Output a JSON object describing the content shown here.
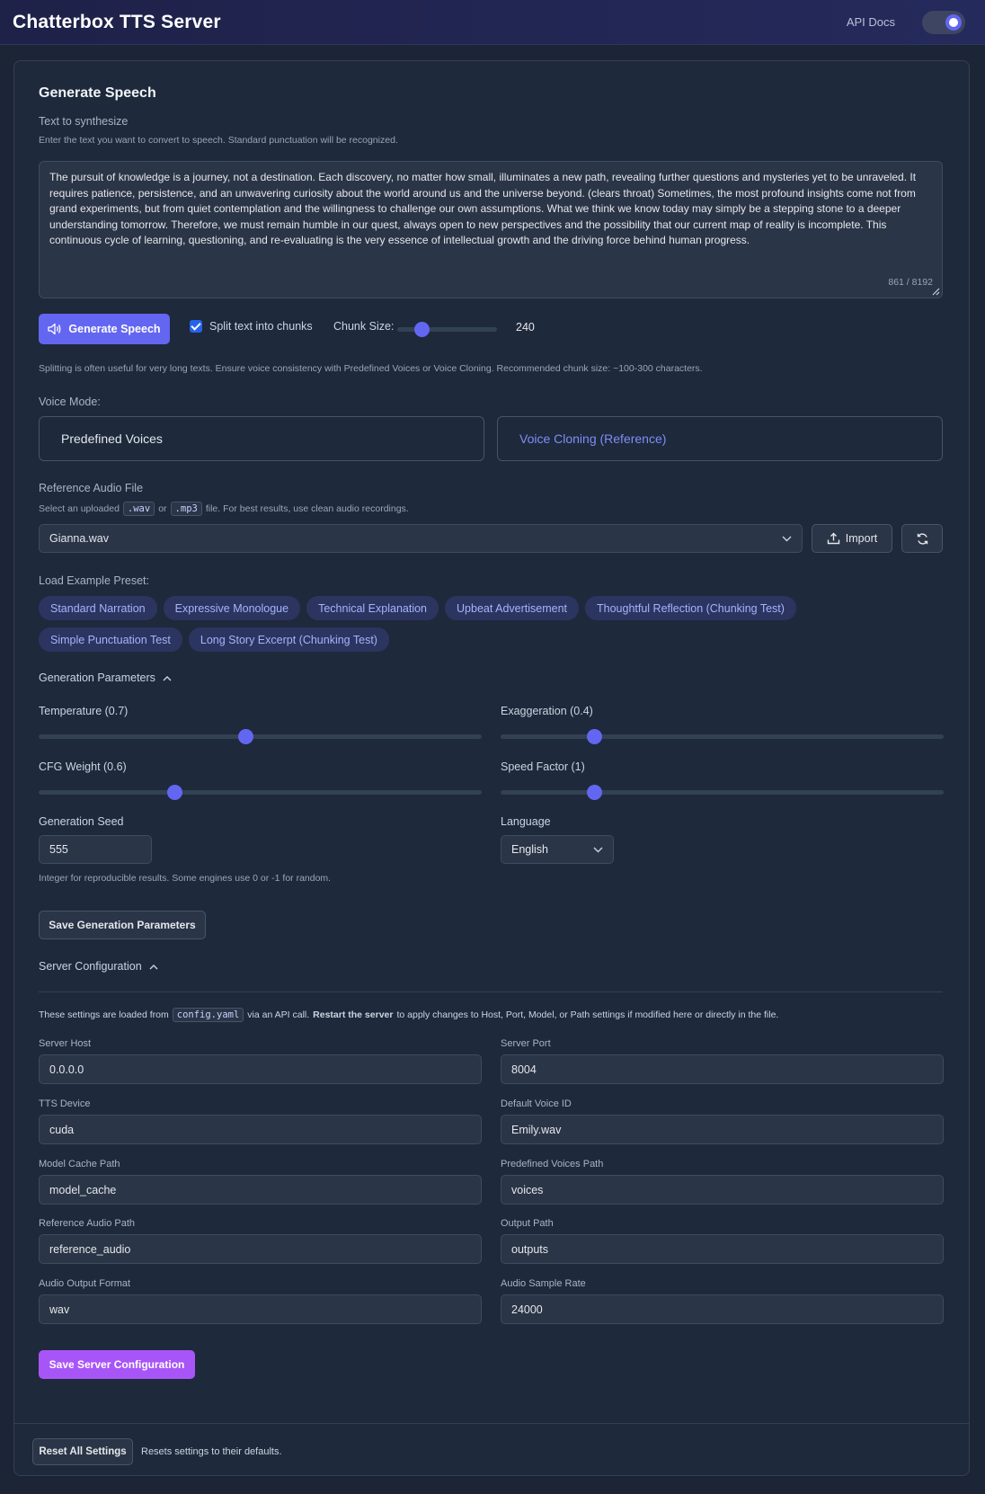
{
  "app": {
    "title": "Chatterbox TTS Server",
    "api_docs": "API Docs"
  },
  "generate": {
    "heading": "Generate Speech",
    "text_label": "Text to synthesize",
    "text_help": "Enter the text you want to convert to speech. Standard punctuation will be recognized.",
    "text_value": "The pursuit of knowledge is a journey, not a destination. Each discovery, no matter how small, illuminates a new path, revealing further questions and mysteries yet to be unraveled. It requires patience, persistence, and an unwavering curiosity about the world around us and the universe beyond. (clears throat) Sometimes, the most profound insights come not from grand experiments, but from quiet contemplation and the willingness to challenge our own assumptions. What we think we know today may simply be a stepping stone to a deeper understanding tomorrow. Therefore, we must remain humble in our quest, always open to new perspectives and the possibility that our current map of reality is incomplete. This continuous cycle of learning, questioning, and re-evaluating is the very essence of intellectual growth and the driving force behind human progress.",
    "char_count": "861 / 8192",
    "button": "Generate Speech",
    "split_label": "Split text into chunks",
    "split_checked": true,
    "chunk_label": "Chunk Size:",
    "chunk_value": "240",
    "chunk_fraction": 0.24,
    "chunk_help": "Splitting is often useful for very long texts. Ensure voice consistency with Predefined Voices or Voice Cloning. Recommended chunk size: ~100-300 characters."
  },
  "voice_mode": {
    "label": "Voice Mode:",
    "predefined": "Predefined Voices",
    "cloning": "Voice Cloning (Reference)",
    "selected": "Voice Cloning (Reference)"
  },
  "reference": {
    "label": "Reference Audio File",
    "help_prefix": "Select an uploaded",
    "ext1": ".wav",
    "help_or": "or",
    "ext2": ".mp3",
    "help_suffix": "file. For best results, use clean audio recordings.",
    "selected_file": "Gianna.wav",
    "import_button": "Import"
  },
  "presets": {
    "label": "Load Example Preset:",
    "items": [
      "Standard Narration",
      "Expressive Monologue",
      "Technical Explanation",
      "Upbeat Advertisement",
      "Thoughtful Reflection (Chunking Test)",
      "Simple Punctuation Test",
      "Long Story Excerpt (Chunking Test)"
    ]
  },
  "gen_params": {
    "heading": "Generation Parameters",
    "temperature_label": "Temperature (0.7)",
    "temperature_fraction": 0.467,
    "exaggeration_label": "Exaggeration (0.4)",
    "exaggeration_fraction": 0.21,
    "cfg_label": "CFG Weight (0.6)",
    "cfg_fraction": 0.307,
    "speed_label": "Speed Factor (1)",
    "speed_fraction": 0.21,
    "seed_label": "Generation Seed",
    "seed_value": "555",
    "seed_help": "Integer for reproducible results. Some engines use 0 or -1 for random.",
    "language_label": "Language",
    "language_value": "English",
    "save_button": "Save Generation Parameters"
  },
  "server_config": {
    "heading": "Server Configuration",
    "help_prefix": "These settings are loaded from",
    "config_file": "config.yaml",
    "help_mid": "via an API call.",
    "help_bold": "Restart the server",
    "help_suffix": "to apply changes to Host, Port, Model, or Path settings if modified here or directly in the file.",
    "fields": {
      "host_label": "Server Host",
      "host_value": "0.0.0.0",
      "port_label": "Server Port",
      "port_value": "8004",
      "device_label": "TTS Device",
      "device_value": "cuda",
      "voice_label": "Default Voice ID",
      "voice_value": "Emily.wav",
      "cache_label": "Model Cache Path",
      "cache_value": "model_cache",
      "voices_path_label": "Predefined Voices Path",
      "voices_path_value": "voices",
      "ref_path_label": "Reference Audio Path",
      "ref_path_value": "reference_audio",
      "output_path_label": "Output Path",
      "output_path_value": "outputs",
      "format_label": "Audio Output Format",
      "format_value": "wav",
      "rate_label": "Audio Sample Rate",
      "rate_value": "24000"
    },
    "save_button": "Save Server Configuration"
  },
  "footer": {
    "reset_button": "Reset All Settings",
    "reset_help": "Resets settings to their defaults."
  },
  "colors": {
    "accent": "#6366f1",
    "purple": "#a855f7",
    "background": "#1c2535",
    "card": "#1e293b"
  }
}
